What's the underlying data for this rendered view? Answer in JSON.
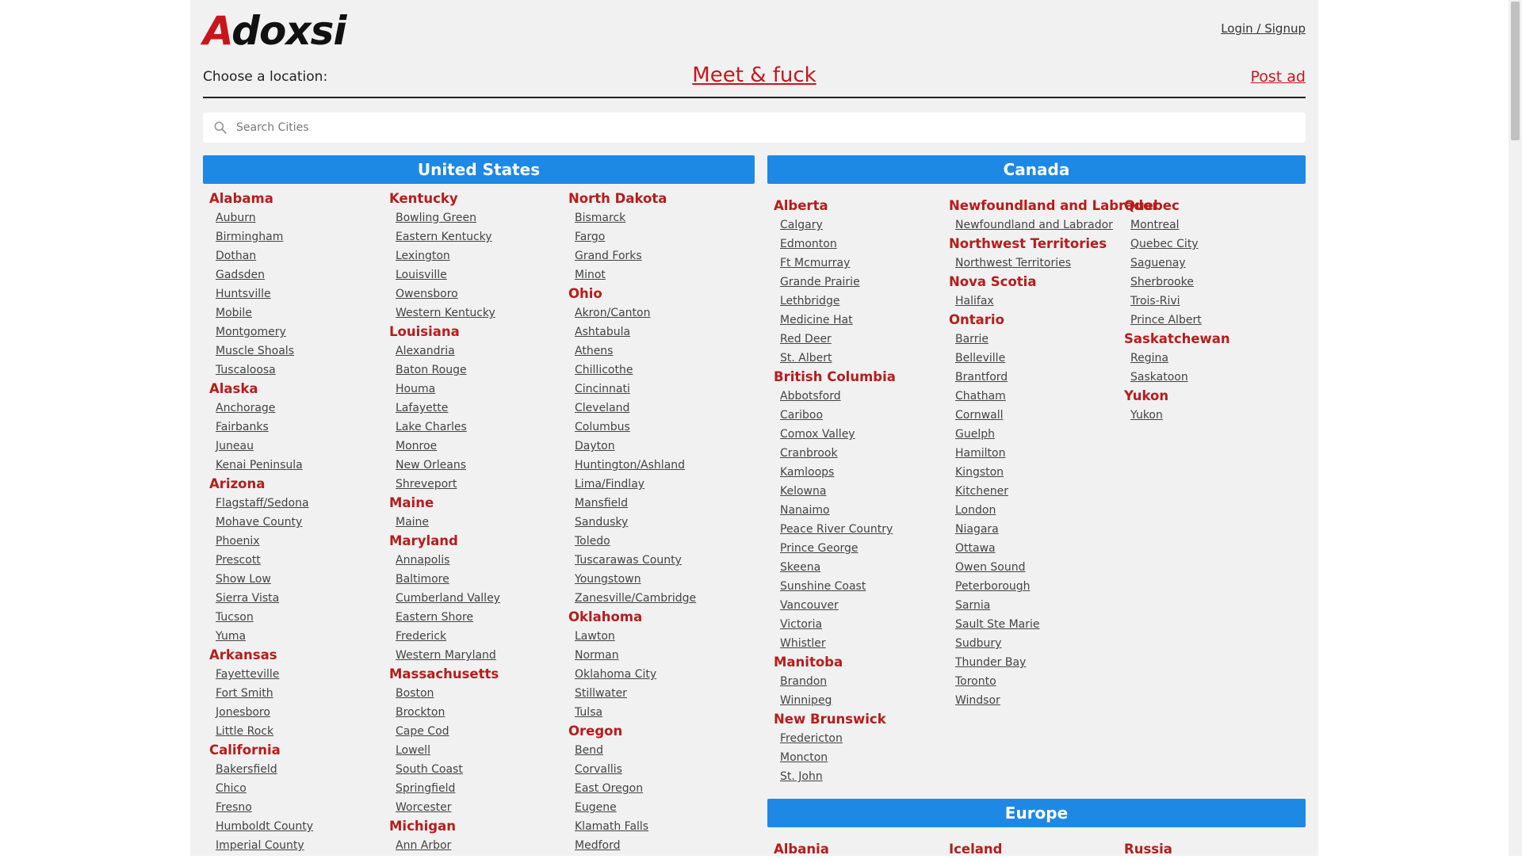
{
  "brand": {
    "logo_first_letter": "A",
    "logo_rest": "doxsi"
  },
  "header": {
    "login_label": "Login / Signup",
    "choose_label": "Choose a location:",
    "meet_label": "Meet & fuck",
    "post_label": "Post ad"
  },
  "search": {
    "placeholder": "Search Cities"
  },
  "colors": {
    "accent_red": "#c8161d",
    "header_blue": "#1e88e5",
    "state_red": "#b71c1c"
  },
  "regions": {
    "us": {
      "title": "United States",
      "columns": [
        [
          {
            "name": "Alabama",
            "cities": [
              "Auburn",
              "Birmingham",
              "Dothan",
              "Gadsden",
              "Huntsville",
              "Mobile",
              "Montgomery",
              "Muscle Shoals",
              "Tuscaloosa"
            ]
          },
          {
            "name": "Alaska",
            "cities": [
              "Anchorage",
              "Fairbanks",
              "Juneau",
              "Kenai Peninsula"
            ]
          },
          {
            "name": "Arizona",
            "cities": [
              "Flagstaff/Sedona",
              "Mohave County",
              "Phoenix",
              "Prescott",
              "Show Low",
              "Sierra Vista",
              "Tucson",
              "Yuma"
            ]
          },
          {
            "name": "Arkansas",
            "cities": [
              "Fayetteville",
              "Fort Smith",
              "Jonesboro",
              "Little Rock"
            ]
          },
          {
            "name": "California",
            "cities": [
              "Bakersfield",
              "Chico",
              "Fresno",
              "Humboldt County",
              "Imperial County"
            ]
          }
        ],
        [
          {
            "name": "Kentucky",
            "cities": [
              "Bowling Green",
              "Eastern Kentucky",
              "Lexington",
              "Louisville",
              "Owensboro",
              "Western Kentucky"
            ]
          },
          {
            "name": "Louisiana",
            "cities": [
              "Alexandria",
              "Baton Rouge",
              "Houma",
              "Lafayette",
              "Lake Charles",
              "Monroe",
              "New Orleans",
              "Shreveport"
            ]
          },
          {
            "name": "Maine",
            "cities": [
              "Maine"
            ]
          },
          {
            "name": "Maryland",
            "cities": [
              "Annapolis",
              "Baltimore",
              "Cumberland Valley",
              "Eastern Shore",
              "Frederick",
              "Western Maryland"
            ]
          },
          {
            "name": "Massachusetts",
            "cities": [
              "Boston",
              "Brockton",
              "Cape Cod",
              "Lowell",
              "South Coast",
              "Springfield",
              "Worcester"
            ]
          },
          {
            "name": "Michigan",
            "cities": [
              "Ann Arbor"
            ]
          }
        ],
        [
          {
            "name": "North Dakota",
            "cities": [
              "Bismarck",
              "Fargo",
              "Grand Forks",
              "Minot"
            ]
          },
          {
            "name": "Ohio",
            "cities": [
              "Akron/Canton",
              "Ashtabula",
              "Athens",
              "Chillicothe",
              "Cincinnati",
              "Cleveland",
              "Columbus",
              "Dayton",
              "Huntington/Ashland",
              "Lima/Findlay",
              "Mansfield",
              "Sandusky",
              "Toledo",
              "Tuscarawas County",
              "Youngstown",
              "Zanesville/Cambridge"
            ]
          },
          {
            "name": "Oklahoma",
            "cities": [
              "Lawton",
              "Norman",
              "Oklahoma City",
              "Stillwater",
              "Tulsa"
            ]
          },
          {
            "name": "Oregon",
            "cities": [
              "Bend",
              "Corvallis",
              "East Oregon",
              "Eugene",
              "Klamath Falls",
              "Medford"
            ]
          }
        ]
      ]
    },
    "canada": {
      "title": "Canada",
      "columns": [
        [
          {
            "name": "Alberta",
            "cities": [
              "Calgary",
              "Edmonton",
              "Ft Mcmurray",
              "Grande Prairie",
              "Lethbridge",
              "Medicine Hat",
              "Red Deer",
              "St. Albert"
            ]
          },
          {
            "name": "British Columbia",
            "cities": [
              "Abbotsford",
              "Cariboo",
              "Comox Valley",
              "Cranbrook",
              "Kamloops",
              "Kelowna",
              "Nanaimo",
              "Peace River Country",
              "Prince George",
              "Skeena",
              "Sunshine Coast",
              "Vancouver",
              "Victoria",
              "Whistler"
            ]
          },
          {
            "name": "Manitoba",
            "cities": [
              "Brandon",
              "Winnipeg"
            ]
          },
          {
            "name": "New Brunswick",
            "cities": [
              "Fredericton",
              "Moncton",
              "St. John"
            ]
          }
        ],
        [
          {
            "name": "Newfoundland and Labrador",
            "cities": [
              "Newfoundland and Labrador"
            ]
          },
          {
            "name": "Northwest Territories",
            "cities": [
              "Northwest Territories"
            ]
          },
          {
            "name": "Nova Scotia",
            "cities": [
              "Halifax"
            ]
          },
          {
            "name": "Ontario",
            "cities": [
              "Barrie",
              "Belleville",
              "Brantford",
              "Chatham",
              "Cornwall",
              "Guelph",
              "Hamilton",
              "Kingston",
              "Kitchener",
              "London",
              "Niagara",
              "Ottawa",
              "Owen Sound",
              "Peterborough",
              "Sarnia",
              "Sault Ste Marie",
              "Sudbury",
              "Thunder Bay",
              "Toronto",
              "Windsor"
            ]
          }
        ],
        [
          {
            "name": "Quebec",
            "cities": [
              "Montreal",
              "Quebec City",
              "Saguenay",
              "Sherbrooke",
              "Trois-Rivi",
              "Prince Albert"
            ]
          },
          {
            "name": "Saskatchewan",
            "cities": [
              "Regina",
              "Saskatoon"
            ]
          },
          {
            "name": "Yukon",
            "cities": [
              "Yukon"
            ]
          }
        ]
      ]
    },
    "europe": {
      "title": "Europe",
      "columns": [
        [
          {
            "name": "Albania",
            "cities": []
          }
        ],
        [
          {
            "name": "Iceland",
            "cities": []
          }
        ],
        [
          {
            "name": "Russia",
            "cities": []
          }
        ]
      ]
    }
  }
}
